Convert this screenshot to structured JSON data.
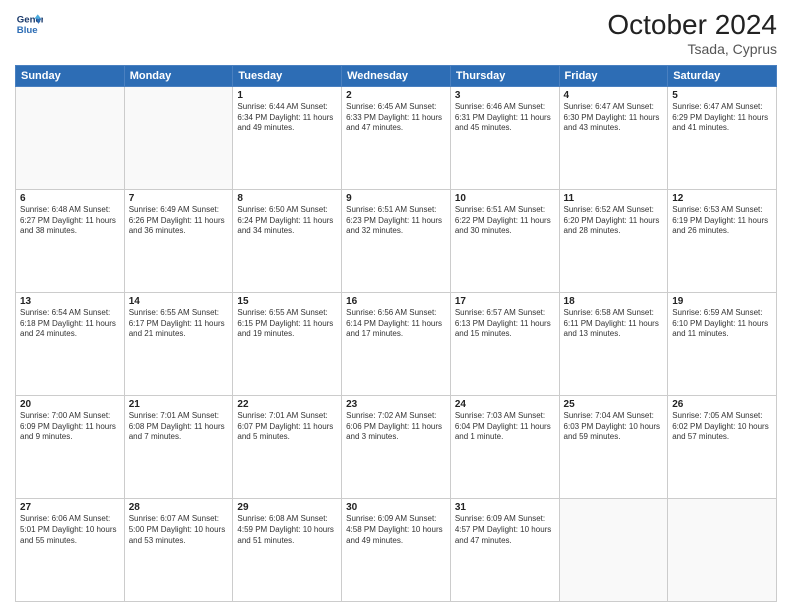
{
  "header": {
    "logo_line1": "General",
    "logo_line2": "Blue",
    "month": "October 2024",
    "location": "Tsada, Cyprus"
  },
  "weekdays": [
    "Sunday",
    "Monday",
    "Tuesday",
    "Wednesday",
    "Thursday",
    "Friday",
    "Saturday"
  ],
  "weeks": [
    [
      {
        "day": "",
        "text": ""
      },
      {
        "day": "",
        "text": ""
      },
      {
        "day": "1",
        "text": "Sunrise: 6:44 AM\nSunset: 6:34 PM\nDaylight: 11 hours\nand 49 minutes."
      },
      {
        "day": "2",
        "text": "Sunrise: 6:45 AM\nSunset: 6:33 PM\nDaylight: 11 hours\nand 47 minutes."
      },
      {
        "day": "3",
        "text": "Sunrise: 6:46 AM\nSunset: 6:31 PM\nDaylight: 11 hours\nand 45 minutes."
      },
      {
        "day": "4",
        "text": "Sunrise: 6:47 AM\nSunset: 6:30 PM\nDaylight: 11 hours\nand 43 minutes."
      },
      {
        "day": "5",
        "text": "Sunrise: 6:47 AM\nSunset: 6:29 PM\nDaylight: 11 hours\nand 41 minutes."
      }
    ],
    [
      {
        "day": "6",
        "text": "Sunrise: 6:48 AM\nSunset: 6:27 PM\nDaylight: 11 hours\nand 38 minutes."
      },
      {
        "day": "7",
        "text": "Sunrise: 6:49 AM\nSunset: 6:26 PM\nDaylight: 11 hours\nand 36 minutes."
      },
      {
        "day": "8",
        "text": "Sunrise: 6:50 AM\nSunset: 6:24 PM\nDaylight: 11 hours\nand 34 minutes."
      },
      {
        "day": "9",
        "text": "Sunrise: 6:51 AM\nSunset: 6:23 PM\nDaylight: 11 hours\nand 32 minutes."
      },
      {
        "day": "10",
        "text": "Sunrise: 6:51 AM\nSunset: 6:22 PM\nDaylight: 11 hours\nand 30 minutes."
      },
      {
        "day": "11",
        "text": "Sunrise: 6:52 AM\nSunset: 6:20 PM\nDaylight: 11 hours\nand 28 minutes."
      },
      {
        "day": "12",
        "text": "Sunrise: 6:53 AM\nSunset: 6:19 PM\nDaylight: 11 hours\nand 26 minutes."
      }
    ],
    [
      {
        "day": "13",
        "text": "Sunrise: 6:54 AM\nSunset: 6:18 PM\nDaylight: 11 hours\nand 24 minutes."
      },
      {
        "day": "14",
        "text": "Sunrise: 6:55 AM\nSunset: 6:17 PM\nDaylight: 11 hours\nand 21 minutes."
      },
      {
        "day": "15",
        "text": "Sunrise: 6:55 AM\nSunset: 6:15 PM\nDaylight: 11 hours\nand 19 minutes."
      },
      {
        "day": "16",
        "text": "Sunrise: 6:56 AM\nSunset: 6:14 PM\nDaylight: 11 hours\nand 17 minutes."
      },
      {
        "day": "17",
        "text": "Sunrise: 6:57 AM\nSunset: 6:13 PM\nDaylight: 11 hours\nand 15 minutes."
      },
      {
        "day": "18",
        "text": "Sunrise: 6:58 AM\nSunset: 6:11 PM\nDaylight: 11 hours\nand 13 minutes."
      },
      {
        "day": "19",
        "text": "Sunrise: 6:59 AM\nSunset: 6:10 PM\nDaylight: 11 hours\nand 11 minutes."
      }
    ],
    [
      {
        "day": "20",
        "text": "Sunrise: 7:00 AM\nSunset: 6:09 PM\nDaylight: 11 hours\nand 9 minutes."
      },
      {
        "day": "21",
        "text": "Sunrise: 7:01 AM\nSunset: 6:08 PM\nDaylight: 11 hours\nand 7 minutes."
      },
      {
        "day": "22",
        "text": "Sunrise: 7:01 AM\nSunset: 6:07 PM\nDaylight: 11 hours\nand 5 minutes."
      },
      {
        "day": "23",
        "text": "Sunrise: 7:02 AM\nSunset: 6:06 PM\nDaylight: 11 hours\nand 3 minutes."
      },
      {
        "day": "24",
        "text": "Sunrise: 7:03 AM\nSunset: 6:04 PM\nDaylight: 11 hours\nand 1 minute."
      },
      {
        "day": "25",
        "text": "Sunrise: 7:04 AM\nSunset: 6:03 PM\nDaylight: 10 hours\nand 59 minutes."
      },
      {
        "day": "26",
        "text": "Sunrise: 7:05 AM\nSunset: 6:02 PM\nDaylight: 10 hours\nand 57 minutes."
      }
    ],
    [
      {
        "day": "27",
        "text": "Sunrise: 6:06 AM\nSunset: 5:01 PM\nDaylight: 10 hours\nand 55 minutes."
      },
      {
        "day": "28",
        "text": "Sunrise: 6:07 AM\nSunset: 5:00 PM\nDaylight: 10 hours\nand 53 minutes."
      },
      {
        "day": "29",
        "text": "Sunrise: 6:08 AM\nSunset: 4:59 PM\nDaylight: 10 hours\nand 51 minutes."
      },
      {
        "day": "30",
        "text": "Sunrise: 6:09 AM\nSunset: 4:58 PM\nDaylight: 10 hours\nand 49 minutes."
      },
      {
        "day": "31",
        "text": "Sunrise: 6:09 AM\nSunset: 4:57 PM\nDaylight: 10 hours\nand 47 minutes."
      },
      {
        "day": "",
        "text": ""
      },
      {
        "day": "",
        "text": ""
      }
    ]
  ]
}
